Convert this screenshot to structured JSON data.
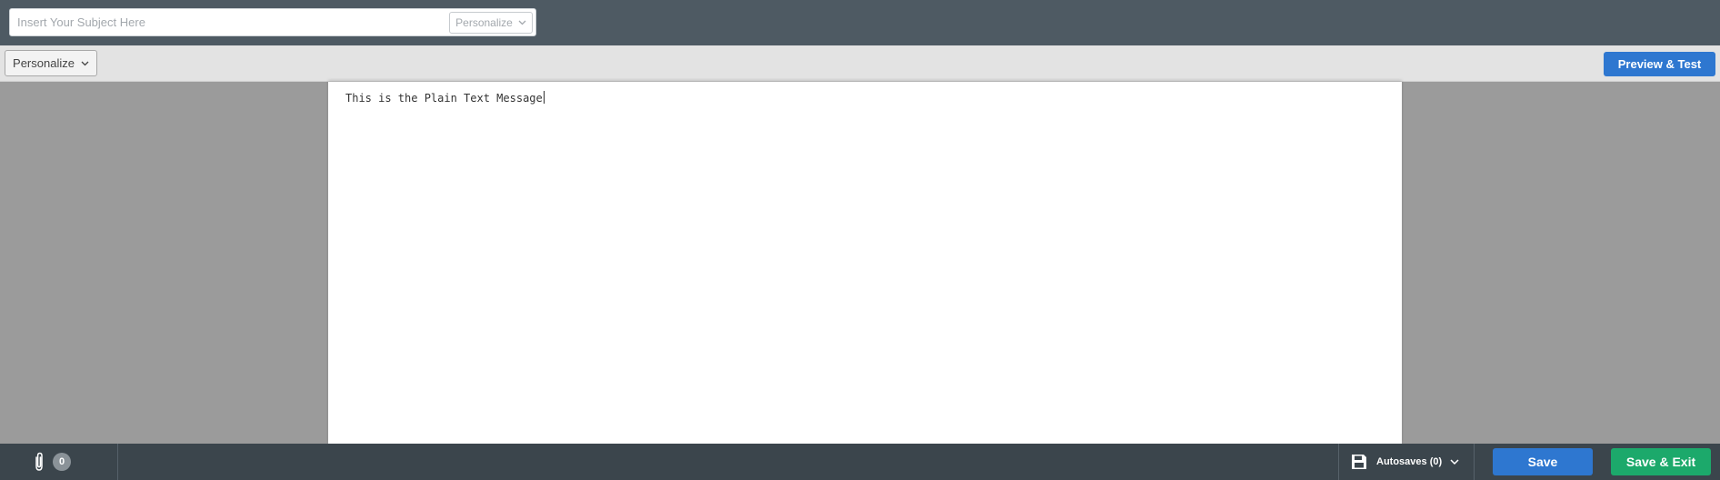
{
  "subject": {
    "placeholder": "Insert Your Subject Here",
    "value": "",
    "personalize_label": "Personalize",
    "personalize_icon": "chevron-down-icon"
  },
  "toolbar": {
    "personalize_label": "Personalize",
    "personalize_icon": "chevron-down-icon",
    "preview_label": "Preview & Test"
  },
  "editor": {
    "content": "This is the Plain Text Message"
  },
  "footer": {
    "attachment_icon": "paperclip-icon",
    "attachment_count": "0",
    "autosave_icon": "floppy-disk-icon",
    "autosaves_label": "Autosaves (0)",
    "autosaves_chevron": "chevron-down-icon",
    "save_label": "Save",
    "save_exit_label": "Save & Exit"
  },
  "colors": {
    "header_bg": "#4e5a63",
    "toolbar_bg": "#e3e3e3",
    "canvas_bg": "#9b9b9b",
    "footer_bg": "#3b454c",
    "primary_blue": "#2e77d0",
    "success_green": "#1ca96b"
  }
}
